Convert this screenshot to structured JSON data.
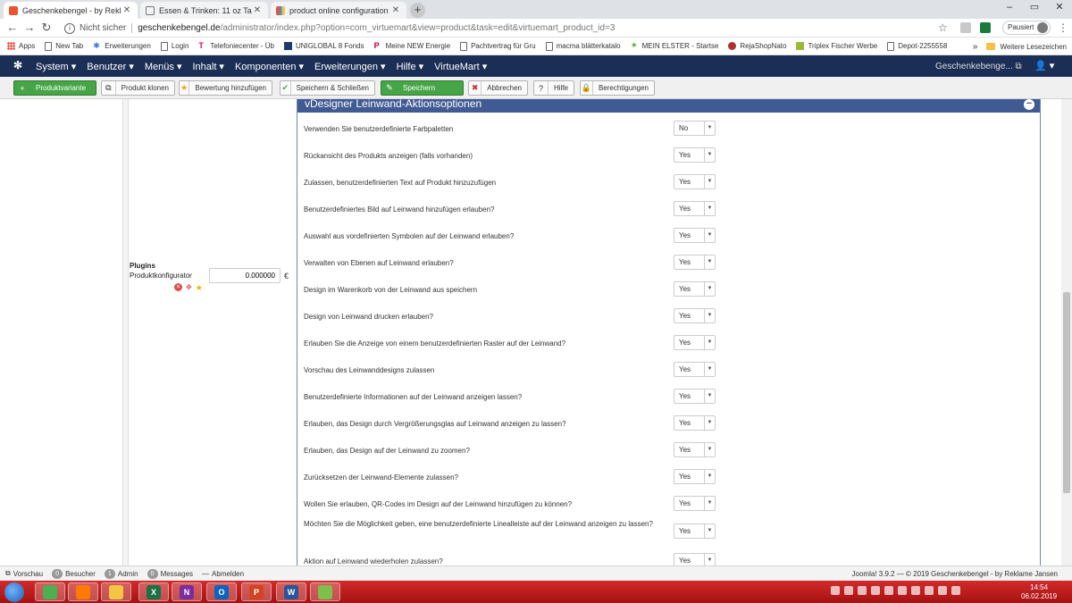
{
  "browser": {
    "tabs": [
      {
        "label": "Geschenkebengel - by Reklame Ja",
        "active": true,
        "color": "#e8542f"
      },
      {
        "label": "Essen & Trinken: 11 oz Tasse Pro",
        "active": false,
        "color": "#777777"
      },
      {
        "label": "product online configuration not",
        "active": false,
        "color": "#4b8bd8"
      }
    ],
    "new_tab": "+",
    "address": {
      "security": "Nicht sicher",
      "domain": "geschenkebengel.de",
      "path": "/administrator/index.php?option=com_virtuemart&view=product&task=edit&virtuemart_product_id=3"
    },
    "profile_status": "Pausiert",
    "bookmarks": [
      {
        "label": "Apps",
        "icon": "apps-grid-icon"
      },
      {
        "label": "New Tab",
        "icon": "page-icon"
      },
      {
        "label": "Erweiterungen",
        "icon": "puzzle-icon"
      },
      {
        "label": "Login",
        "icon": "page-icon"
      },
      {
        "label": "Telefoniecenter - Üb",
        "icon": "telekom-icon"
      },
      {
        "label": "UNIGLOBAL 8 Fonds",
        "icon": "chart-icon"
      },
      {
        "label": "Meine NEW Energie",
        "icon": "p-icon"
      },
      {
        "label": "Pachtvertrag für Gru",
        "icon": "page-icon"
      },
      {
        "label": "macma blätterkatalo",
        "icon": "page-icon"
      },
      {
        "label": "MEIN ELSTER - Startse",
        "icon": "star-icon"
      },
      {
        "label": "RejaShopNato",
        "icon": "cart-icon"
      },
      {
        "label": "Triplex Fischer Werbe",
        "icon": "t-icon"
      },
      {
        "label": "Depot-2255558",
        "icon": "page-icon"
      }
    ],
    "bookmarks_more": "»",
    "bookmarks_other": "Weitere Lesezeichen"
  },
  "joomla": {
    "menu": [
      "System ▾",
      "Benutzer ▾",
      "Menüs ▾",
      "Inhalt ▾",
      "Komponenten ▾",
      "Erweiterungen ▾",
      "Hilfe ▾",
      "VirtueMart ▾"
    ],
    "site_link": "Geschenkebenge... ⧉",
    "user": "👤 ▾"
  },
  "toolbar": [
    {
      "label": "Produktvariante",
      "icon": "+",
      "style": "green"
    },
    {
      "label": "Produkt klonen",
      "icon": "⧉",
      "style": "default"
    },
    {
      "label": "Bewertung hinzufügen",
      "icon": "★",
      "style": "default"
    },
    {
      "label": "Speichern & Schließen",
      "icon": "✔",
      "style": "default"
    },
    {
      "label": "Speichern",
      "icon": "✎",
      "style": "green"
    },
    {
      "label": "Abbrechen",
      "icon": "✖",
      "style": "default"
    },
    {
      "label": "Hilfe",
      "icon": "?",
      "style": "default"
    },
    {
      "label": "Berechtigungen",
      "icon": "🔒",
      "style": "default"
    }
  ],
  "plugins": {
    "title": "Plugins",
    "subtitle": "Produktkonfigurator",
    "price_value": "0.000000",
    "currency": "€"
  },
  "panel": {
    "title": "vDesigner Leinwand-Aktionsoptionen",
    "collapse": "−",
    "options": [
      {
        "label": "Verwenden Sie benutzerdefinierte Farbpaletten",
        "value": "No"
      },
      {
        "label": "Rückansicht des Produkts anzeigen (falls vorhanden)",
        "value": "Yes"
      },
      {
        "label": "Zulassen, benutzerdefinierten Text auf Produkt hinzuzufügen",
        "value": "Yes"
      },
      {
        "label": "Benutzerdefiniertes Bild auf Leinwand hinzufügen erlauben?",
        "value": "Yes"
      },
      {
        "label": "Auswahl aus vordefinierten Symbolen auf der Leinwand erlauben?",
        "value": "Yes"
      },
      {
        "label": "Verwalten von Ebenen auf Leinwand erlauben?",
        "value": "Yes"
      },
      {
        "label": "Design im Warenkorb von der Leinwand aus speichern",
        "value": "Yes"
      },
      {
        "label": "Design von Leinwand drucken erlauben?",
        "value": "Yes"
      },
      {
        "label": "Erlauben Sie die Anzeige von einem benutzerdefinierten Raster auf der Leinwand?",
        "value": "Yes"
      },
      {
        "label": "Vorschau des Leinwanddesigns zulassen",
        "value": "Yes"
      },
      {
        "label": "Benutzerdefinierte Informationen auf der Leinwand anzeigen lassen?",
        "value": "Yes"
      },
      {
        "label": "Erlauben, das Design durch Vergrößerungsglas auf Leinwand anzeigen zu lassen?",
        "value": "Yes"
      },
      {
        "label": "Erlauben, das Design auf der Leinwand zu zoomen?",
        "value": "Yes"
      },
      {
        "label": "Zurücksetzen der Leinwand-Elemente zulassen?",
        "value": "Yes"
      },
      {
        "label": "Wollen Sie erlauben, QR-Codes im Design auf der Leinwand hinzufügen zu können?",
        "value": "Yes"
      },
      {
        "label": "Möchten Sie die Möglichkeit geben, eine benutzerdefinierte Linealleiste auf der Leinwand anzeigen zu lassen?",
        "value": "Yes"
      },
      {
        "label": "Aktion auf Leinwand wiederholen zulassen?",
        "value": "Yes"
      }
    ]
  },
  "status": {
    "preview": "Vorschau",
    "visitors_count": "0",
    "visitors": "Besucher",
    "admins_count": "1",
    "admins": "Admin",
    "messages_count": "0",
    "messages": "Messages",
    "logout": "Abmelden",
    "copyright": "Joomla! 3.9.2 — © 2019 Geschenkebengel - by Reklame Jansen"
  },
  "taskbar": {
    "apps": [
      {
        "name": "chrome",
        "label": "",
        "color": "#4caf50"
      },
      {
        "name": "firefox",
        "label": "",
        "color": "#ff7a00"
      },
      {
        "name": "explorer",
        "label": "",
        "color": "#f4c542"
      },
      {
        "name": "excel",
        "label": "X",
        "color": "#1d7044"
      },
      {
        "name": "onenote",
        "label": "N",
        "color": "#7b2c9e"
      },
      {
        "name": "outlook",
        "label": "O",
        "color": "#0a64c2"
      },
      {
        "name": "powerpoint",
        "label": "P",
        "color": "#d04423"
      },
      {
        "name": "word",
        "label": "W",
        "color": "#2a5699"
      },
      {
        "name": "notepad",
        "label": "",
        "color": "#7dbf4a"
      }
    ],
    "time": "14:54",
    "date": "06.02.2019"
  }
}
